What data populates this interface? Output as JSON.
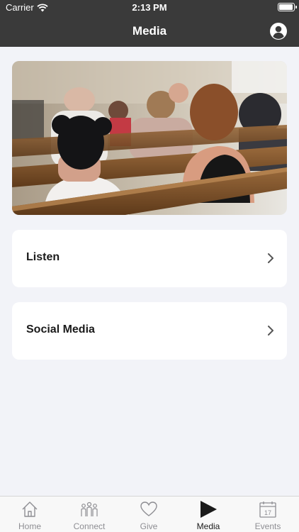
{
  "status_bar": {
    "carrier": "Carrier",
    "time": "2:13 PM",
    "battery_level": 1.0
  },
  "nav": {
    "title": "Media",
    "profile_icon": "person-circle-icon"
  },
  "hero": {
    "icon": "congregation-photo"
  },
  "cards": [
    {
      "label": "Listen",
      "icon": "chevron-right-icon"
    },
    {
      "label": "Social Media",
      "icon": "chevron-right-icon"
    }
  ],
  "tabs": [
    {
      "label": "Home",
      "icon": "home-icon",
      "active": false
    },
    {
      "label": "Connect",
      "icon": "people-icon",
      "active": false
    },
    {
      "label": "Give",
      "icon": "heart-icon",
      "active": false
    },
    {
      "label": "Media",
      "icon": "play-icon",
      "active": true
    },
    {
      "label": "Events",
      "icon": "calendar-icon",
      "day": "17",
      "active": false
    }
  ],
  "colors": {
    "header": "#3a3a3a",
    "background": "#f2f3f8",
    "tab_inactive": "#8e8e93"
  }
}
